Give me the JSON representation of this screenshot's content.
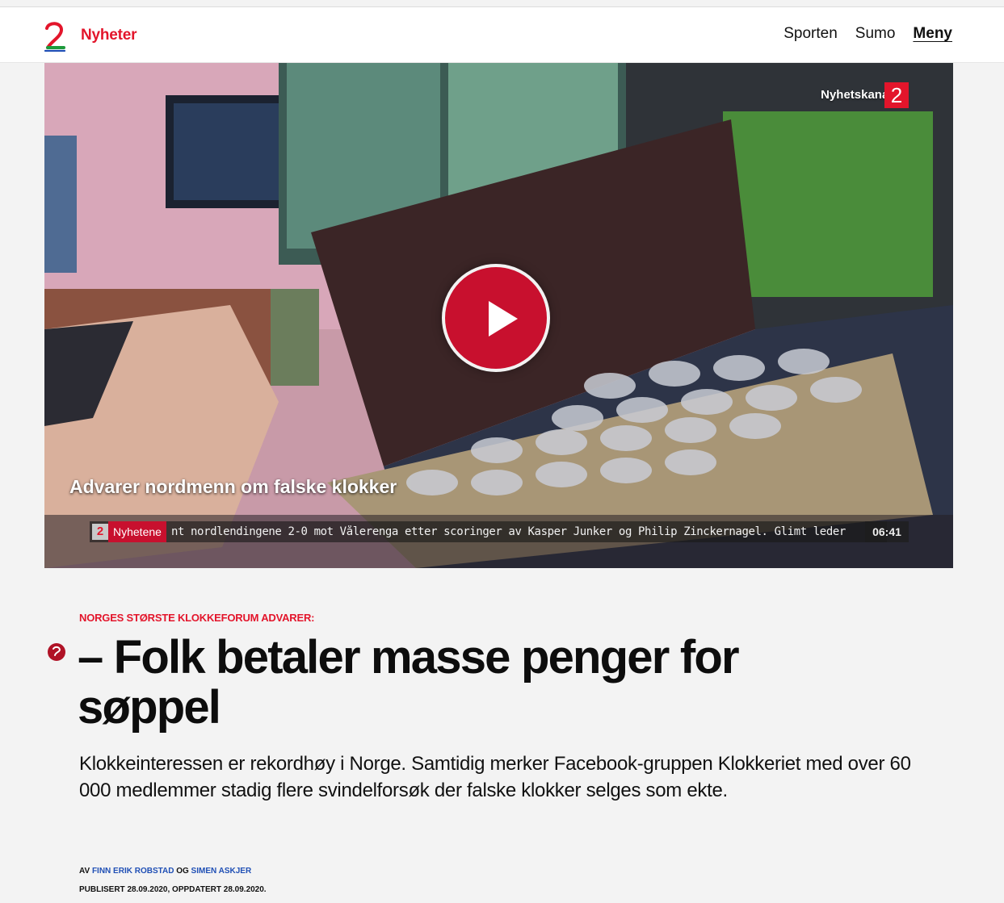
{
  "header": {
    "brand": "Nyheter",
    "nav": [
      {
        "label": "Sporten"
      },
      {
        "label": "Sumo"
      },
      {
        "label": "Meny"
      }
    ]
  },
  "video": {
    "channel_label": "Nyhetskanalen",
    "channel_badge": "2",
    "title": "Advarer nordmenn om falske klokker",
    "ticker_badge": "2",
    "ticker_label": "Nyhetene",
    "ticker_text": "nt nordlendingene 2-0 mot Vålerenga etter scoringer av Kasper Junker og Philip Zinckernagel. Glimt leder",
    "duration": "06:41",
    "play_icon": "play-icon"
  },
  "article": {
    "kicker": "NORGES STØRSTE KLOKKEFORUM ADVARER:",
    "headline": "– Folk betaler masse penger for søppel",
    "lead": "Klokkeinteressen er rekordhøy i Norge. Samtidig merker Facebook-gruppen Klokkeriet med over 60 000 medlemmer stadig flere svindelforsøk der falske klokker selges som ekte.",
    "byline": {
      "prefix": "AV",
      "author1": "FINN ERIK ROBSTAD",
      "joiner": "OG",
      "author2": "SIMEN ASKJER"
    },
    "published": "PUBLISERT 28.09.2020, OPPDATERT 28.09.2020."
  },
  "colors": {
    "accent": "#e3152b",
    "link": "#1f4fb5",
    "background": "#f3f3f3"
  }
}
